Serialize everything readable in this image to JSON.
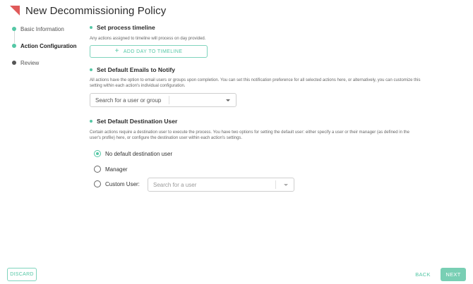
{
  "header": {
    "title": "New Decommissioning Policy",
    "logo_color": "#e05a5a"
  },
  "stepper": {
    "steps": [
      {
        "label": "Basic Information",
        "state": "complete"
      },
      {
        "label": "Action Configuration",
        "state": "active"
      },
      {
        "label": "Review",
        "state": "pending"
      }
    ],
    "colors": {
      "complete": "#54c7a5",
      "active": "#54c7a5",
      "pending": "#555555"
    }
  },
  "timeline": {
    "title": "Set process timeline",
    "description": "Any actions assigned to timeline will process on day provided.",
    "add_button_label": "ADD DAY TO TIMELINE",
    "add_button_icon": "plus-icon"
  },
  "emails": {
    "title": "Set Default Emails to Notify",
    "description": "All actions have the option to email users or groups upon completion. You can set this notification preference for all selected actions here, or alternatively, you can customize this setting within each action's individual configuration.",
    "search_placeholder": "Search for a user or group"
  },
  "destination": {
    "title": "Set Default Destination User",
    "description": "Certain actions require a destination user to execute the process. You have two options for setting the default user: either specify a user or their manager (as defined in the user's profile) here, or configure the destination user within each action's settings.",
    "options": [
      {
        "label": "No default destination user",
        "checked": true
      },
      {
        "label": "Manager",
        "checked": false
      },
      {
        "label": "Custom User:",
        "checked": false
      }
    ],
    "custom_user_placeholder": "Search for a user"
  },
  "footer": {
    "discard_label": "DISCARD",
    "back_label": "BACK",
    "next_label": "NEXT"
  },
  "theme": {
    "accent": "#54c7a5",
    "primary_button": "#79cfb4"
  }
}
